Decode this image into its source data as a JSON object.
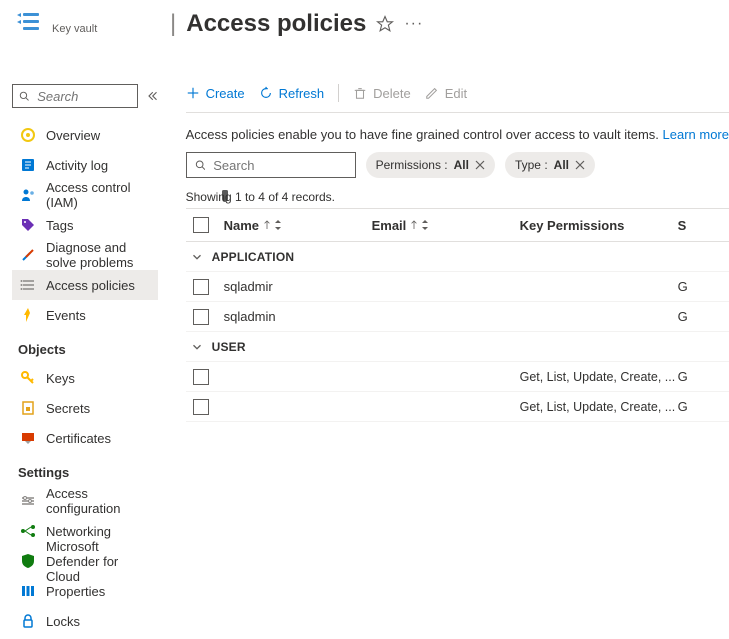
{
  "resource_type": "Key vault",
  "page": {
    "title": "Access policies"
  },
  "sidebar": {
    "search_placeholder": "Search",
    "items": [
      {
        "icon": "overview-icon",
        "color": "#f2c811",
        "label": "Overview"
      },
      {
        "icon": "activity-log-icon",
        "color": "#0078d4",
        "label": "Activity log"
      },
      {
        "icon": "iam-icon",
        "color": "#0078d4",
        "label": "Access control (IAM)"
      },
      {
        "icon": "tags-icon",
        "color": "#6b2fb5",
        "label": "Tags"
      },
      {
        "icon": "diagnose-icon",
        "color": "#0078d4",
        "label": "Diagnose and solve problems"
      },
      {
        "icon": "policies-icon",
        "color": "#8a8886",
        "label": "Access policies",
        "active": true
      },
      {
        "icon": "events-icon",
        "color": "#ffb900",
        "label": "Events"
      }
    ],
    "sections": [
      {
        "title": "Objects",
        "items": [
          {
            "icon": "keys-icon",
            "color": "#ffb900",
            "label": "Keys"
          },
          {
            "icon": "secrets-icon",
            "color": "#e3a21a",
            "label": "Secrets"
          },
          {
            "icon": "certificates-icon",
            "color": "#d83b01",
            "label": "Certificates"
          }
        ]
      },
      {
        "title": "Settings",
        "items": [
          {
            "icon": "access-config-icon",
            "color": "#8a8886",
            "label": "Access configuration"
          },
          {
            "icon": "networking-icon",
            "color": "#107c10",
            "label": "Networking"
          },
          {
            "icon": "defender-icon",
            "color": "#107c10",
            "label": "Microsoft Defender for Cloud"
          },
          {
            "icon": "properties-icon",
            "color": "#0078d4",
            "label": "Properties"
          },
          {
            "icon": "locks-icon",
            "color": "#0078d4",
            "label": "Locks"
          }
        ]
      }
    ]
  },
  "toolbar": {
    "create": "Create",
    "refresh": "Refresh",
    "delete": "Delete",
    "edit": "Edit"
  },
  "description": {
    "text": "Access policies enable you to have fine grained control over access to vault items. ",
    "link": "Learn more"
  },
  "filters": {
    "search_placeholder": "Search",
    "perm_label": "Permissions : ",
    "perm_value": "All",
    "type_label": "Type : ",
    "type_value": "All"
  },
  "table": {
    "count": "Showing 1 to 4 of 4 records.",
    "headers": {
      "name": "Name",
      "email": "Email",
      "keyperm": "Key Permissions",
      "secretperm_initial": "S"
    },
    "groups": [
      {
        "label": "APPLICATION",
        "rows": [
          {
            "name": "sqladmir",
            "email": "",
            "keyperm": "",
            "sp": "G"
          },
          {
            "name": "sqladmin",
            "email": "",
            "keyperm": "",
            "sp": "G"
          }
        ]
      },
      {
        "label": "USER",
        "rows": [
          {
            "name": "",
            "email": "",
            "keyperm": "Get, List, Update, Create, ...",
            "sp": "G"
          },
          {
            "name": "",
            "email": "",
            "keyperm": "Get, List, Update, Create, ...",
            "sp": "G"
          }
        ]
      }
    ]
  }
}
